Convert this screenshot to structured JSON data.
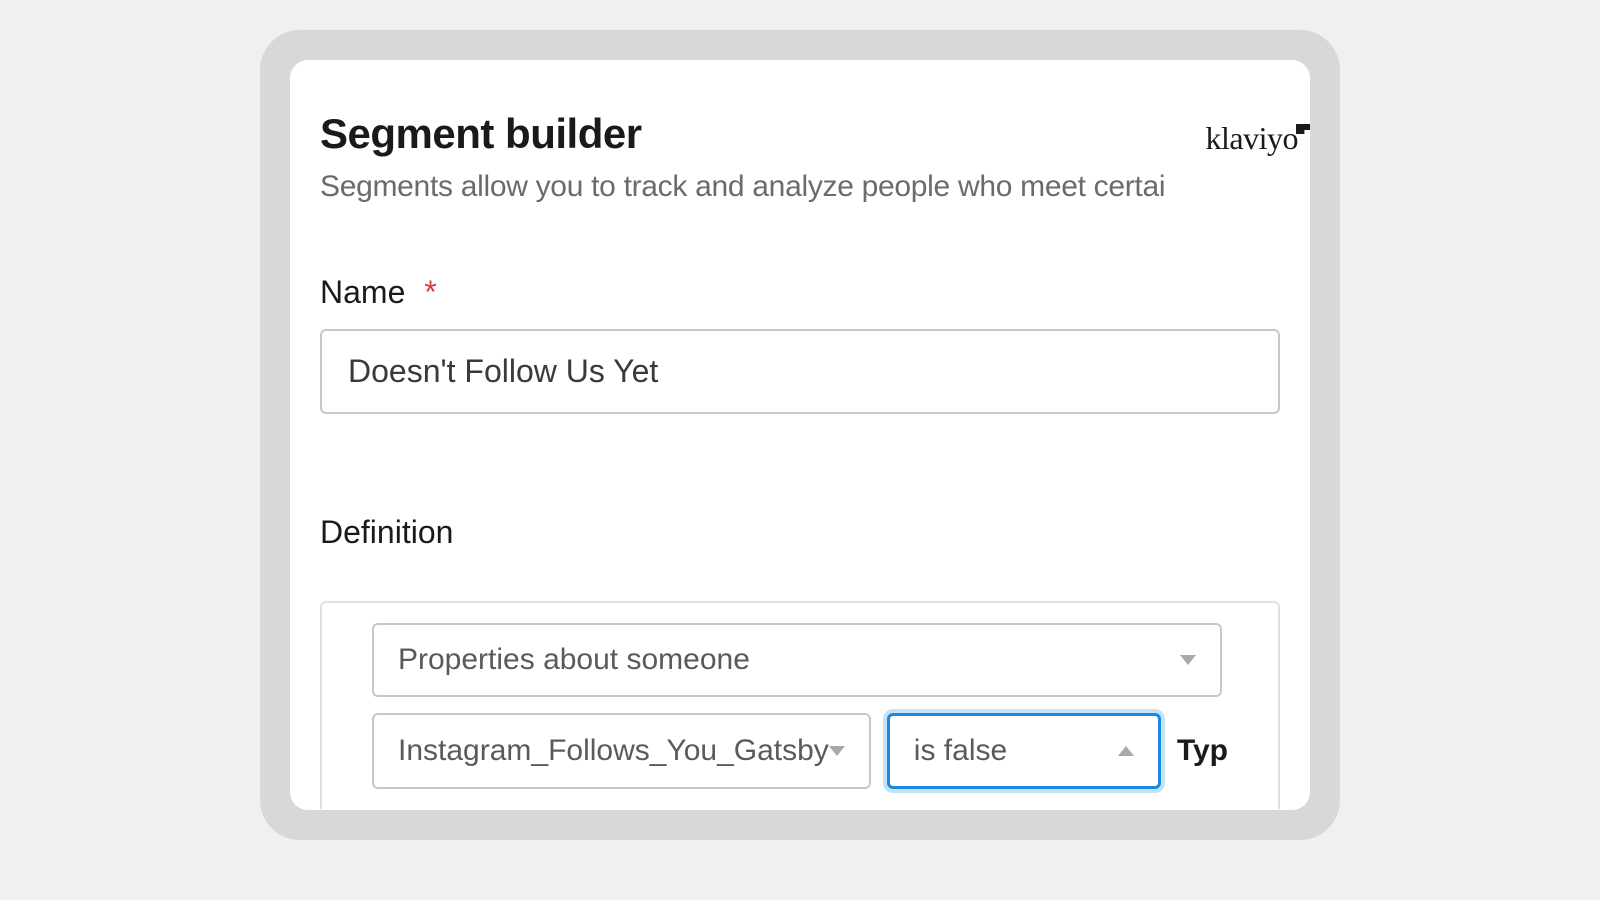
{
  "brand": {
    "logo_text": "klaviyo"
  },
  "header": {
    "title": "Segment builder",
    "subtitle": "Segments allow you to track and analyze people who meet certai"
  },
  "form": {
    "name": {
      "label": "Name",
      "required_marker": "*",
      "value": "Doesn't Follow Us Yet"
    },
    "definition": {
      "heading": "Definition",
      "condition_type": {
        "selected": "Properties about someone"
      },
      "property": {
        "selected": "Instagram_Follows_You_Gatsby"
      },
      "operator": {
        "selected": "is false"
      },
      "type_label": "Typ"
    }
  }
}
